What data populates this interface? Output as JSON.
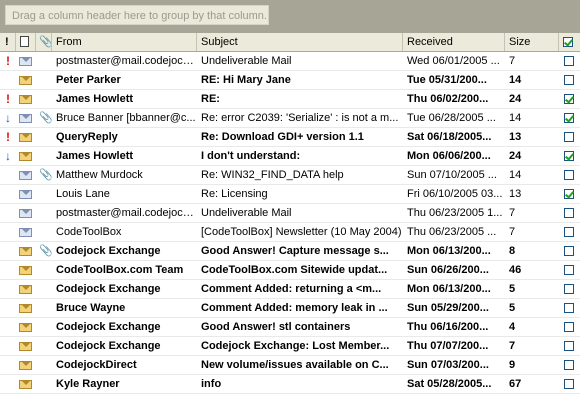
{
  "group_hint": "Drag a column header here to group by that column.",
  "columns": {
    "importance": "!",
    "from": "From",
    "subject": "Subject",
    "received": "Received",
    "size": "Size"
  },
  "rows": [
    {
      "imp": "high",
      "read": true,
      "att": false,
      "unread": false,
      "from": "postmaster@mail.codejock...",
      "subject": "Undeliverable Mail",
      "received": "Wed 06/01/2005 ...",
      "size": "7",
      "flag": false
    },
    {
      "imp": "",
      "read": false,
      "att": false,
      "unread": true,
      "from": "Peter Parker",
      "subject": "RE: Hi Mary Jane",
      "received": "Tue 05/31/200...",
      "size": "14",
      "flag": false
    },
    {
      "imp": "high",
      "read": false,
      "att": false,
      "unread": true,
      "from": "James Howlett",
      "subject": "RE:",
      "received": "Thu 06/02/200...",
      "size": "24",
      "flag": true
    },
    {
      "imp": "low",
      "read": true,
      "att": true,
      "unread": false,
      "from": "Bruce Banner [bbanner@c...",
      "subject": "Re: error C2039: 'Serialize' : is not a m...",
      "received": "Tue 06/28/2005 ...",
      "size": "14",
      "flag": true
    },
    {
      "imp": "high",
      "read": false,
      "att": false,
      "unread": true,
      "from": "QueryReply",
      "subject": "Re: Download GDI+ version 1.1",
      "received": "Sat 06/18/2005...",
      "size": "13",
      "flag": false
    },
    {
      "imp": "low",
      "read": false,
      "att": false,
      "unread": true,
      "from": "James Howlett",
      "subject": "I don't understand:",
      "received": "Mon 06/06/200...",
      "size": "24",
      "flag": true
    },
    {
      "imp": "",
      "read": true,
      "att": true,
      "unread": false,
      "from": "Matthew Murdock",
      "subject": "Re: WIN32_FIND_DATA help",
      "received": "Sun 07/10/2005 ...",
      "size": "14",
      "flag": false
    },
    {
      "imp": "",
      "read": true,
      "att": false,
      "unread": false,
      "from": "Louis Lane",
      "subject": "Re: Licensing",
      "received": "Fri 06/10/2005 03...",
      "size": "13",
      "flag": true
    },
    {
      "imp": "",
      "read": true,
      "att": false,
      "unread": false,
      "from": "postmaster@mail.codejock...",
      "subject": "Undeliverable Mail",
      "received": "Thu 06/23/2005 1...",
      "size": "7",
      "flag": false
    },
    {
      "imp": "",
      "read": true,
      "att": false,
      "unread": false,
      "from": "CodeToolBox",
      "subject": "[CodeToolBox] Newsletter (10 May 2004)",
      "received": "Thu 06/23/2005 ...",
      "size": "7",
      "flag": false
    },
    {
      "imp": "",
      "read": false,
      "att": true,
      "unread": true,
      "from": "Codejock Exchange",
      "subject": "Good Answer! Capture message s...",
      "received": "Mon 06/13/200...",
      "size": "8",
      "flag": false
    },
    {
      "imp": "",
      "read": false,
      "att": false,
      "unread": true,
      "from": "CodeToolBox.com Team",
      "subject": "CodeToolBox.com Sitewide updat...",
      "received": "Sun 06/26/200...",
      "size": "46",
      "flag": false
    },
    {
      "imp": "",
      "read": false,
      "att": false,
      "unread": true,
      "from": "Codejock Exchange",
      "subject": "Comment Added: returning a <m...",
      "received": "Mon 06/13/200...",
      "size": "5",
      "flag": false
    },
    {
      "imp": "",
      "read": false,
      "att": false,
      "unread": true,
      "from": "Bruce Wayne",
      "subject": "Comment Added: memory leak in ...",
      "received": "Sun 05/29/200...",
      "size": "5",
      "flag": false
    },
    {
      "imp": "",
      "read": false,
      "att": false,
      "unread": true,
      "from": "Codejock Exchange",
      "subject": "Good Answer! stl containers",
      "received": "Thu 06/16/200...",
      "size": "4",
      "flag": false
    },
    {
      "imp": "",
      "read": false,
      "att": false,
      "unread": true,
      "from": "Codejock Exchange",
      "subject": "Codejock Exchange:  Lost Member...",
      "received": "Thu 07/07/200...",
      "size": "7",
      "flag": false
    },
    {
      "imp": "",
      "read": false,
      "att": false,
      "unread": true,
      "from": "CodejockDirect",
      "subject": "New volume/issues available on C...",
      "received": "Sun 07/03/200...",
      "size": "9",
      "flag": false
    },
    {
      "imp": "",
      "read": false,
      "att": false,
      "unread": true,
      "from": "Kyle Rayner",
      "subject": "info",
      "received": "Sat 05/28/2005...",
      "size": "67",
      "flag": false
    }
  ]
}
